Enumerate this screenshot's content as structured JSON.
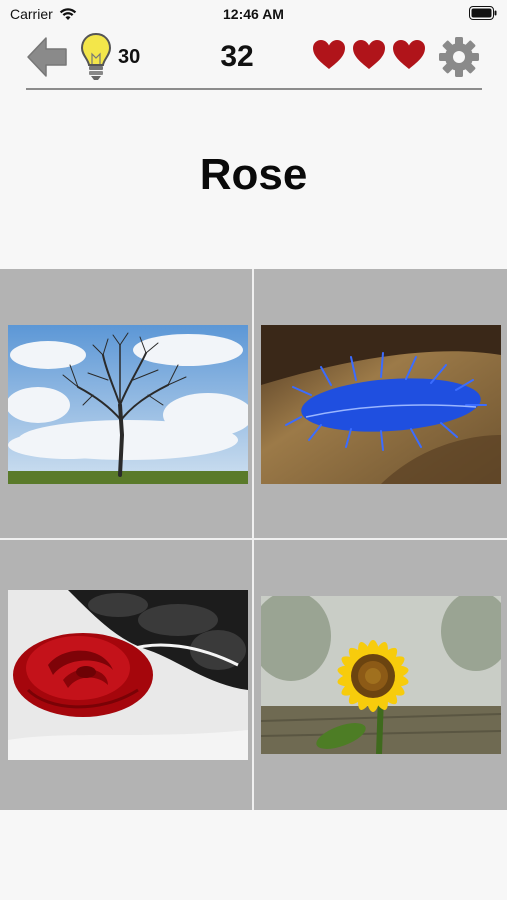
{
  "status_bar": {
    "carrier": "Carrier",
    "time": "12:46 AM"
  },
  "toolbar": {
    "hint_count": "30",
    "score": "32",
    "lives": 3,
    "heart_color": "#b0141a",
    "gear_color": "#8a8a8a",
    "bulb_color": "#f3e64a"
  },
  "question": {
    "word": "Rose"
  },
  "answers": [
    {
      "icon": "tree-photo"
    },
    {
      "icon": "blue-feather-photo"
    },
    {
      "icon": "red-rose-photo"
    },
    {
      "icon": "sunflower-photo"
    }
  ]
}
